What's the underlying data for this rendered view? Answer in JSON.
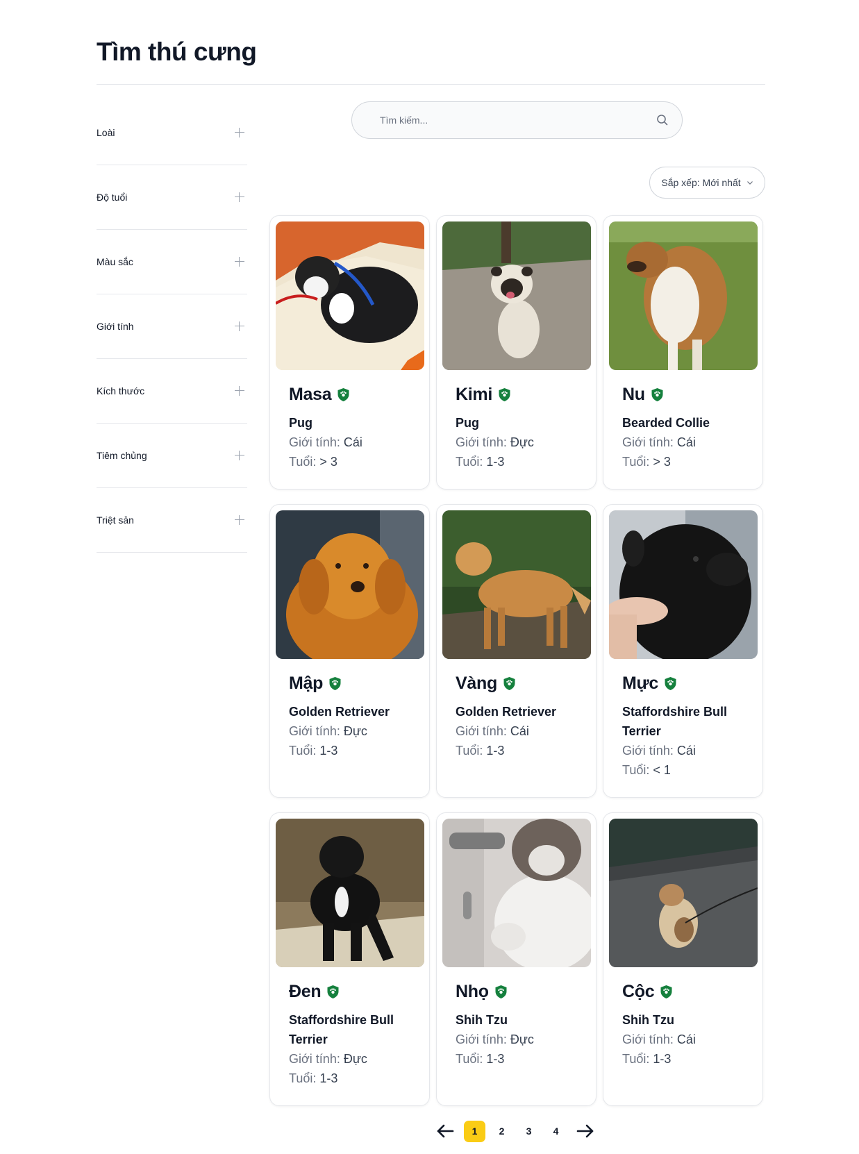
{
  "page": {
    "title": "Tìm thú cưng"
  },
  "filters": [
    {
      "label": "Loài"
    },
    {
      "label": "Độ tuổi"
    },
    {
      "label": "Màu sắc"
    },
    {
      "label": "Giới tính"
    },
    {
      "label": "Kích thước"
    },
    {
      "label": "Tiêm chủng"
    },
    {
      "label": "Triệt sản"
    }
  ],
  "search": {
    "placeholder": "Tìm kiếm...",
    "value": ""
  },
  "sort": {
    "label": "Sắp xếp: Mới nhất"
  },
  "labels": {
    "gender": "Giới tính: ",
    "age": "Tuổi: "
  },
  "pets": [
    {
      "name": "Masa",
      "breed": "Pug",
      "gender": "Cái",
      "age": "> 3",
      "verified": true,
      "icon": "verified-shield-icon"
    },
    {
      "name": "Kimi",
      "breed": "Pug",
      "gender": "Đực",
      "age": "1-3",
      "verified": true,
      "icon": "verified-shield-icon"
    },
    {
      "name": "Nu",
      "breed": "Bearded Collie",
      "gender": "Cái",
      "age": "> 3",
      "verified": true,
      "icon": "verified-shield-icon"
    },
    {
      "name": "Mập",
      "breed": "Golden Retriever",
      "gender": "Đực",
      "age": "1-3",
      "verified": true,
      "icon": "verified-shield-icon"
    },
    {
      "name": "Vàng",
      "breed": "Golden Retriever",
      "gender": "Cái",
      "age": "1-3",
      "verified": true,
      "icon": "verified-shield-icon"
    },
    {
      "name": "Mực",
      "breed": "Staffordshire Bull Terrier",
      "gender": "Cái",
      "age": "< 1",
      "verified": true,
      "icon": "verified-shield-icon"
    },
    {
      "name": "Đen",
      "breed": "Staffordshire Bull Terrier",
      "gender": "Đực",
      "age": "1-3",
      "verified": true,
      "icon": "verified-shield-icon"
    },
    {
      "name": "Nhọ",
      "breed": "Shih Tzu",
      "gender": "Đực",
      "age": "1-3",
      "verified": true,
      "icon": "verified-shield-icon"
    },
    {
      "name": "Cộc",
      "breed": "Shih Tzu",
      "gender": "Cái",
      "age": "1-3",
      "verified": true,
      "icon": "verified-shield-icon"
    }
  ],
  "pagination": {
    "pages": [
      "1",
      "2",
      "3",
      "4"
    ],
    "current": "1"
  },
  "colors": {
    "accent": "#facc15",
    "verified": "#15803d",
    "border": "#e5e7eb",
    "muted": "#6b7280"
  }
}
